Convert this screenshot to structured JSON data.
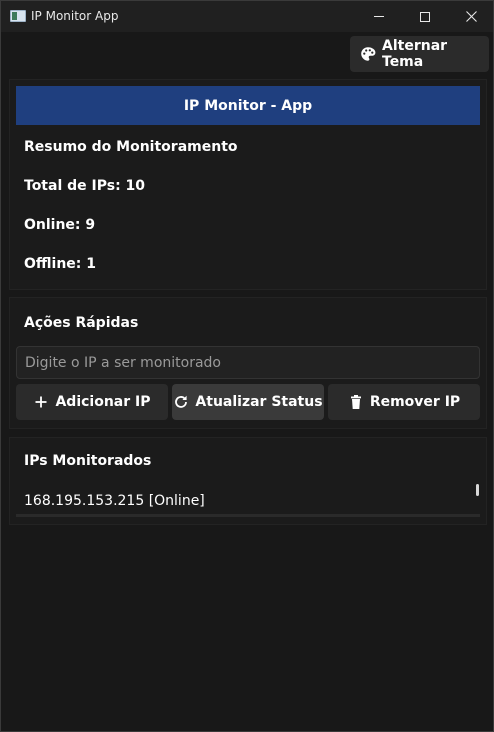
{
  "window": {
    "title": "IP Monitor App",
    "minimize_label": "—",
    "close_label": "✕"
  },
  "theme_button": {
    "label": "Alternar Tema",
    "icon": "palette-icon"
  },
  "header": {
    "title": "IP Monitor - App",
    "background_color": "#1f3f7f"
  },
  "summary": {
    "heading": "Resumo do Monitoramento",
    "total": "Total de IPs: 10",
    "online": "Online: 9",
    "offline": "Offline: 1"
  },
  "actions": {
    "heading": "Ações Rápidas",
    "input_placeholder": "Digite o IP a ser monitorado",
    "input_value": "",
    "add_label": "Adicionar IP",
    "refresh_label": "Atualizar Status",
    "remove_label": "Remover IP"
  },
  "monitored": {
    "heading": "IPs Monitorados",
    "items": [
      "168.195.153.215 [Online]"
    ]
  }
}
